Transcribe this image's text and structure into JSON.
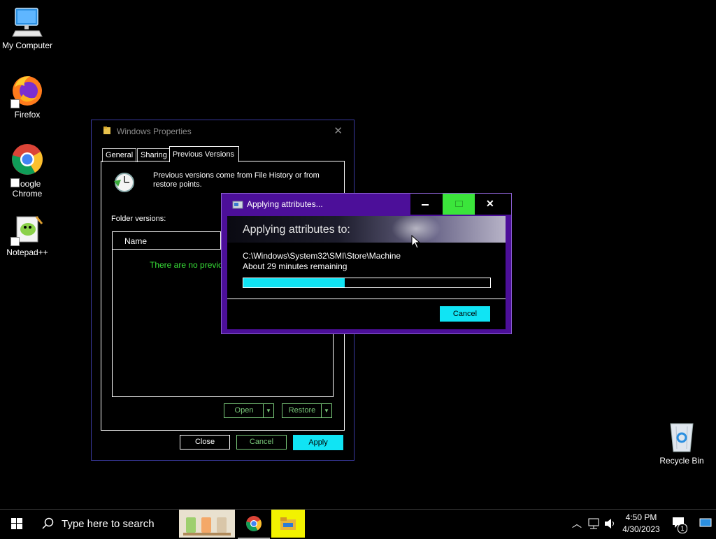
{
  "desktop": {
    "icons": [
      {
        "label": "My Computer",
        "icon": "computer-icon"
      },
      {
        "label": "Firefox",
        "icon": "firefox-icon"
      },
      {
        "label": "Google Chrome",
        "icon": "chrome-icon"
      },
      {
        "label": "Notepad++",
        "icon": "notepadpp-icon"
      },
      {
        "label": "Recycle Bin",
        "icon": "recycle-bin-icon"
      }
    ]
  },
  "properties_dialog": {
    "title": "Windows Properties",
    "tabs": [
      "General",
      "Sharing",
      "Previous Versions"
    ],
    "active_tab": "Previous Versions",
    "info_text": "Previous versions come from File History or from restore points.",
    "folder_versions_label": "Folder versions:",
    "column_name": "Name",
    "empty_text": "There are no previo",
    "open_label": "Open",
    "restore_label": "Restore",
    "close_label": "Close",
    "cancel_label": "Cancel",
    "apply_label": "Apply"
  },
  "apply_dialog": {
    "title": "Applying attributes...",
    "heading": "Applying attributes to:",
    "path": "C:\\Windows\\System32\\SMI\\Store\\Machine",
    "remaining": "About 29 minutes remaining",
    "progress_fraction": 0.41,
    "cancel_label": "Cancel"
  },
  "taskbar": {
    "search_placeholder": "Type here to search",
    "time": "4:50 PM",
    "date": "4/30/2023",
    "notification_count": "1"
  },
  "colors": {
    "accent_cyan": "#10e4f4",
    "green_text": "#38e038",
    "purple_frame": "#4c0f99",
    "maximize_green": "#3be53b"
  }
}
